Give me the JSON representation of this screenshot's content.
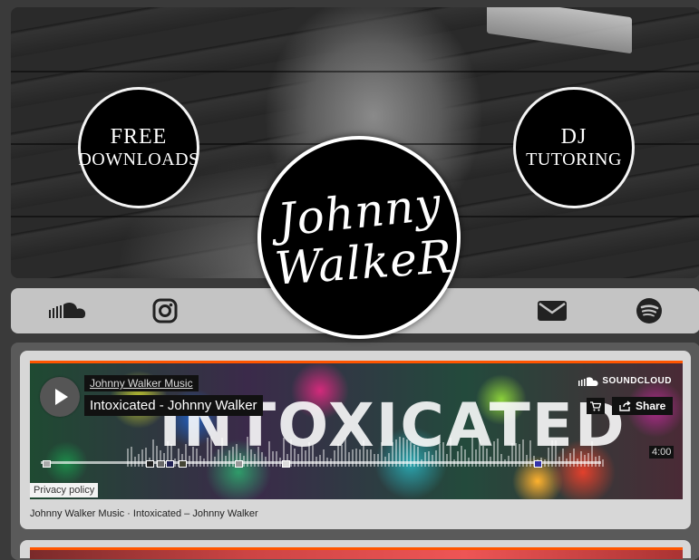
{
  "hero": {
    "free_downloads": {
      "line1": "FREE",
      "line2": "DOWNLOADS"
    },
    "dj_tutoring": {
      "line1": "DJ",
      "line2": "TUTORING"
    },
    "logo": {
      "line1": "Johnny",
      "line2": "WalkeR"
    }
  },
  "social": {
    "items": [
      {
        "name": "soundcloud-icon"
      },
      {
        "name": "instagram-icon"
      },
      {
        "name": "mail-icon"
      },
      {
        "name": "spotify-icon"
      }
    ]
  },
  "player": {
    "artist": "Johnny Walker Music",
    "track_title": "Intoxicated - Johnny Walker",
    "cover_text": "INTOXICATED",
    "brand": "SOUNDCLOUD",
    "share_label": "Share",
    "duration": "4:00",
    "accent_color": "#ff5500"
  },
  "privacy_label": "Privacy policy",
  "caption": "Johnny Walker Music · Intoxicated – Johnny Walker"
}
